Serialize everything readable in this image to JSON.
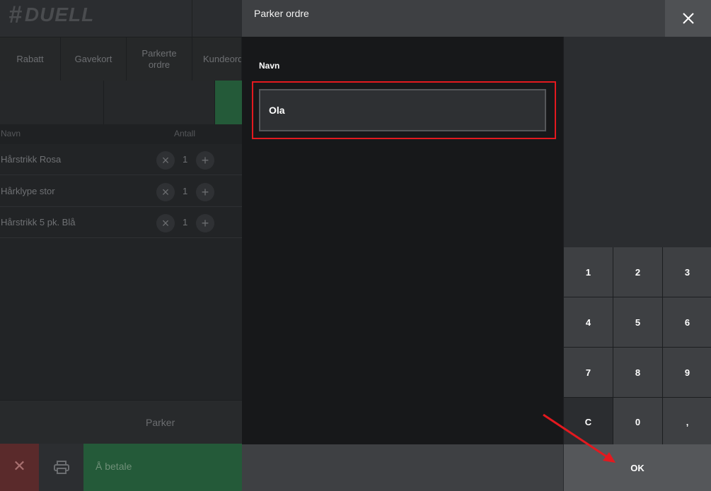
{
  "app": {
    "logo_text": "DUELL"
  },
  "background": {
    "tabs": [
      {
        "label": "Rabatt"
      },
      {
        "label": "Gavekort"
      },
      {
        "label": "Parkerte ordre"
      },
      {
        "label": "Kundeordre"
      }
    ],
    "list_headers": {
      "name": "Navn",
      "qty": "Antall"
    },
    "items": [
      {
        "name": "Hårstrikk Rosa",
        "qty": "1"
      },
      {
        "name": "Hårklype stor",
        "qty": "1"
      },
      {
        "name": "Hårstrikk 5 pk. Blå",
        "qty": "1"
      }
    ],
    "park_label": "Parker",
    "pay_label": "Å betale",
    "colors": {
      "pay_green": "#245a39",
      "cancel_red": "#5a2a2b"
    }
  },
  "modal": {
    "title": "Parker ordre",
    "field_label": "Navn",
    "name_value": "Ola",
    "keypad": [
      "1",
      "2",
      "3",
      "4",
      "5",
      "6",
      "7",
      "8",
      "9",
      "C",
      "0",
      ","
    ],
    "ok_label": "OK",
    "colors": {
      "highlight": "#e3191f",
      "arrow": "#e3191f"
    }
  }
}
